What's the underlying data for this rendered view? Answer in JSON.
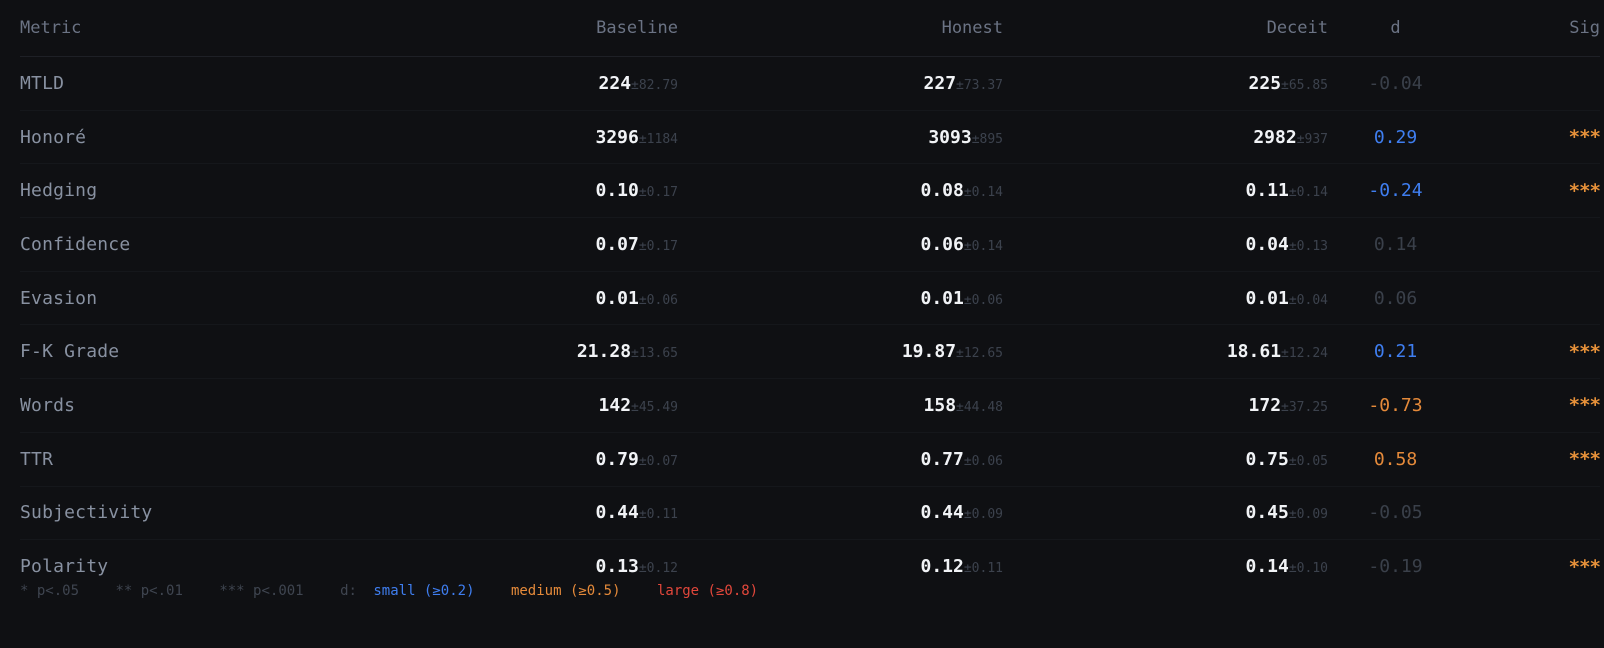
{
  "headers": {
    "metric": "Metric",
    "baseline": "Baseline",
    "honest": "Honest",
    "deceit": "Deceit",
    "d": "d",
    "sig": "Sig"
  },
  "rows": [
    {
      "metric": "MTLD",
      "baseline": {
        "v": "224",
        "sd": "±82.79"
      },
      "honest": {
        "v": "227",
        "sd": "±73.37"
      },
      "deceit": {
        "v": "225",
        "sd": "±65.85"
      },
      "d": "-0.04",
      "d_class": "muted",
      "sig": ""
    },
    {
      "metric": "Honoré",
      "baseline": {
        "v": "3296",
        "sd": "±1184"
      },
      "honest": {
        "v": "3093",
        "sd": "±895"
      },
      "deceit": {
        "v": "2982",
        "sd": "±937"
      },
      "d": "0.29",
      "d_class": "small",
      "sig": "***"
    },
    {
      "metric": "Hedging",
      "baseline": {
        "v": "0.10",
        "sd": "±0.17"
      },
      "honest": {
        "v": "0.08",
        "sd": "±0.14"
      },
      "deceit": {
        "v": "0.11",
        "sd": "±0.14"
      },
      "d": "-0.24",
      "d_class": "small",
      "sig": "***"
    },
    {
      "metric": "Confidence",
      "baseline": {
        "v": "0.07",
        "sd": "±0.17"
      },
      "honest": {
        "v": "0.06",
        "sd": "±0.14"
      },
      "deceit": {
        "v": "0.04",
        "sd": "±0.13"
      },
      "d": "0.14",
      "d_class": "muted",
      "sig": ""
    },
    {
      "metric": "Evasion",
      "baseline": {
        "v": "0.01",
        "sd": "±0.06"
      },
      "honest": {
        "v": "0.01",
        "sd": "±0.06"
      },
      "deceit": {
        "v": "0.01",
        "sd": "±0.04"
      },
      "d": "0.06",
      "d_class": "muted",
      "sig": ""
    },
    {
      "metric": "F-K Grade",
      "baseline": {
        "v": "21.28",
        "sd": "±13.65"
      },
      "honest": {
        "v": "19.87",
        "sd": "±12.65"
      },
      "deceit": {
        "v": "18.61",
        "sd": "±12.24"
      },
      "d": "0.21",
      "d_class": "small",
      "sig": "***"
    },
    {
      "metric": "Words",
      "baseline": {
        "v": "142",
        "sd": "±45.49"
      },
      "honest": {
        "v": "158",
        "sd": "±44.48"
      },
      "deceit": {
        "v": "172",
        "sd": "±37.25"
      },
      "d": "-0.73",
      "d_class": "medium",
      "sig": "***"
    },
    {
      "metric": "TTR",
      "baseline": {
        "v": "0.79",
        "sd": "±0.07"
      },
      "honest": {
        "v": "0.77",
        "sd": "±0.06"
      },
      "deceit": {
        "v": "0.75",
        "sd": "±0.05"
      },
      "d": "0.58",
      "d_class": "medium",
      "sig": "***"
    },
    {
      "metric": "Subjectivity",
      "baseline": {
        "v": "0.44",
        "sd": "±0.11"
      },
      "honest": {
        "v": "0.44",
        "sd": "±0.09"
      },
      "deceit": {
        "v": "0.45",
        "sd": "±0.09"
      },
      "d": "-0.05",
      "d_class": "muted",
      "sig": ""
    },
    {
      "metric": "Polarity",
      "baseline": {
        "v": "0.13",
        "sd": "±0.12"
      },
      "honest": {
        "v": "0.12",
        "sd": "±0.11"
      },
      "deceit": {
        "v": "0.14",
        "sd": "±0.10"
      },
      "d": "-0.19",
      "d_class": "muted",
      "sig": "***"
    }
  ],
  "legend": {
    "p05": "* p<.05",
    "p01": "** p<.01",
    "p001": "*** p<.001",
    "d_label": "d:",
    "small": "small (≥0.2)",
    "medium": "medium (≥0.5)",
    "large": "large (≥0.8)"
  },
  "colors": {
    "background": "#0f1013",
    "effect_small": "#3f7ef0",
    "effect_medium": "#e58a3a",
    "effect_large": "#e2473b",
    "significance": "#e8923a"
  }
}
